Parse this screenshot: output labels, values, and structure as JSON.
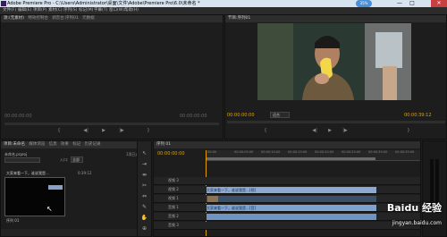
{
  "window": {
    "title": "Adobe Premiere Pro - C:\\Users\\Administrator\\桌面\\文件\\Adobe\\Premiere Pro\\6.0\\未命名 *",
    "min": "—",
    "max": "□",
    "close": "✕",
    "badge": "35%"
  },
  "menu": [
    "文件(F)",
    "编辑(E)",
    "项目(P)",
    "素材(C)",
    "序列(S)",
    "标记(M)",
    "字幕(T)",
    "窗口(W)",
    "帮助(H)"
  ],
  "source_panel": {
    "tabs": [
      "源:(无素材)",
      "特效控制台",
      "调音台:序列01",
      "元数据"
    ],
    "timecode_left": "00:00:00:00",
    "timecode_right": "00:00:00:00"
  },
  "program_panel": {
    "tab": "节目:序列01",
    "timecode_current": "00:00:00:00",
    "fit": "适合",
    "timecode_duration": "00:00:39:12"
  },
  "project_panel": {
    "tabs": [
      "项目:未命名",
      "媒体浏览",
      "信息",
      "效果",
      "标记",
      "历史记录"
    ],
    "project_file": "未命名.prproj",
    "in_label": "入口:",
    "all": "全部",
    "item_count": "1项已选",
    "file_name": "大家来看一下，谁说我是…",
    "file_duration": "0:39:12",
    "thumbnail_label": "序列 01"
  },
  "sequence_panel": {
    "tab": "序列 01",
    "timecode": "00:00:00:00",
    "ruler": [
      "00:00",
      "00:00:05:00",
      "00:00:10:00",
      "00:00:15:00",
      "00:00:20:00",
      "00:00:25:00",
      "00:00:30:00",
      "00:00:35:00"
    ],
    "tracks": [
      {
        "id": "v3",
        "label": "视频 3"
      },
      {
        "id": "v2",
        "label": "视频 2"
      },
      {
        "id": "v1",
        "label": "视频 1"
      },
      {
        "id": "a1",
        "label": "音频 1"
      },
      {
        "id": "a2",
        "label": "音频 2"
      },
      {
        "id": "a3",
        "label": "音频 3"
      }
    ],
    "clip_video_text": "大家来看一下，谁说我是…[视]",
    "clip_audio_text": "大家来看一下，谁说我是…[音]"
  },
  "watermark": "Baidu 经验",
  "watermark_url": "jingyan.baidu.com",
  "icons": {
    "play": "▶",
    "step_back": "◀|",
    "step_fwd": "|▶",
    "mark_in": "{",
    "mark_out": "}",
    "selection": "↖",
    "razor": "✂",
    "hand": "✋",
    "zoom": "🔍",
    "pen": "✎"
  },
  "colors": {
    "timecode": "#e0a000",
    "clip_video": "#8ea9d1",
    "clip_audio": "#7fa3d0",
    "playhead": "#e0a000"
  }
}
